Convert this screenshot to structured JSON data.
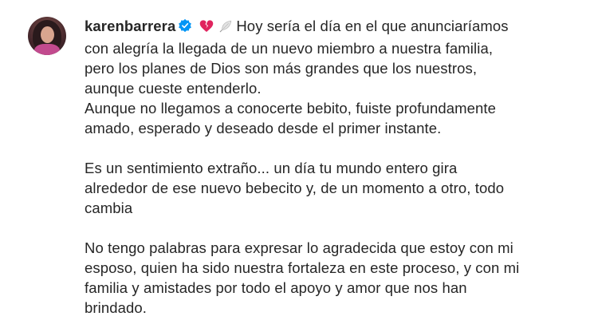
{
  "post": {
    "username": "karenbarrera",
    "verified_icon": "verified-badge-icon",
    "emojis": [
      "broken-heart-icon",
      "feather-icon"
    ],
    "colors": {
      "text": "#262626",
      "verified": "#0095f6",
      "heart": "#e0245e"
    },
    "caption_lines": {
      "l1": "Hoy sería el día en el que anunciaríamos",
      "l2": "con alegría la llegada de un nuevo miembro a nuestra familia,",
      "l3": "pero los planes de Dios son más grandes que los nuestros,",
      "l4": "aunque cueste entenderlo.",
      "l5": "Aunque no llegamos a conocerte bebito, fuiste profundamente",
      "l6": "amado, esperado y deseado desde el primer instante.",
      "l7": "Es un sentimiento extraño... un día tu mundo entero gira",
      "l8": "alrededor de ese nuevo bebecito y, de un momento a otro, todo",
      "l9": "cambia",
      "l10": "No tengo palabras para expresar lo agradecida que estoy con mi",
      "l11": "esposo, quien ha sido nuestra fortaleza en este proceso, y con mi",
      "l12": "familia y amistades por todo el apoyo y amor que nos han",
      "l13": "brindado."
    }
  }
}
